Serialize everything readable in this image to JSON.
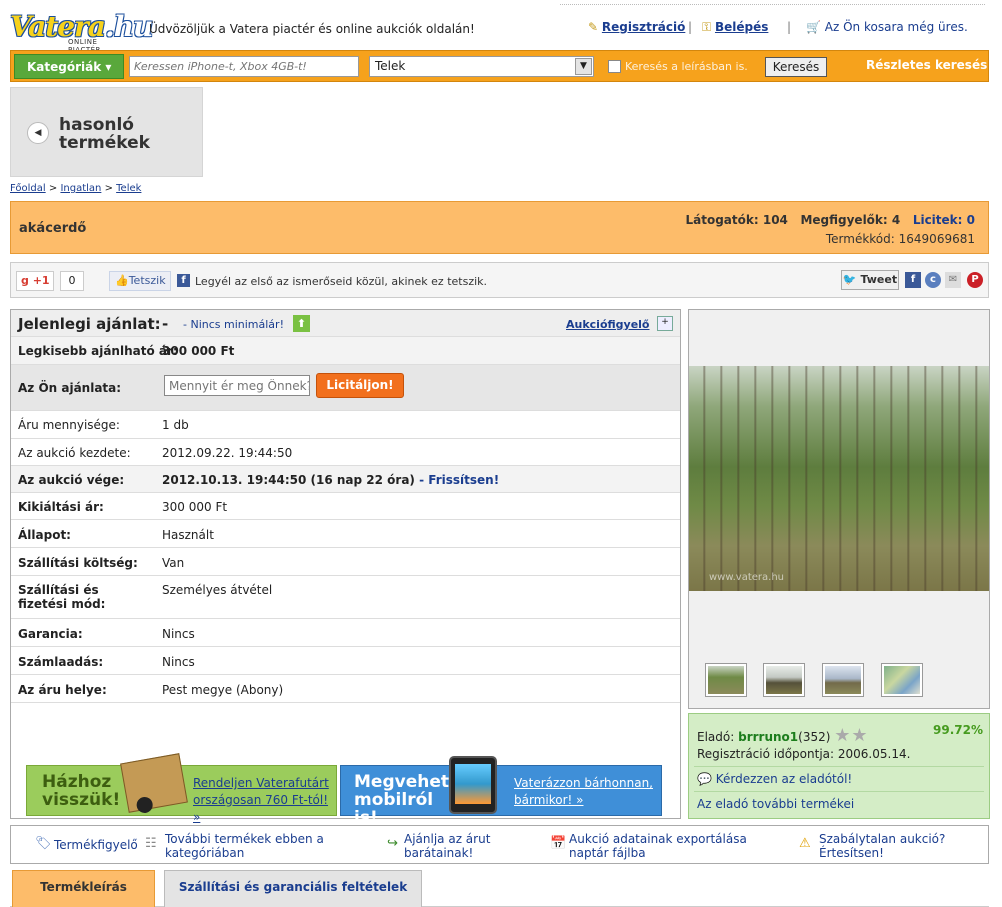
{
  "header": {
    "logo_text": "Vatera",
    "logo_domain": ".hu",
    "logo_sub": "ONLINE PIACTÉR",
    "welcome": "Üdvözöljük a Vatera piactér és online aukciók oldalán!",
    "register": "Regisztráció",
    "login": "Belépés",
    "sep": "|",
    "cart": "Az Ön kosara még üres."
  },
  "search": {
    "categories_btn": "Kategóriák ▾",
    "placeholder": "Keressen iPhone-t, Xbox 4GB-t!",
    "selected_category": "Telek",
    "in_description": "Keresés a leírásban is.",
    "search_btn": "Keresés",
    "advanced": "Részletes keresés"
  },
  "similar": {
    "label": "hasonló termékek"
  },
  "breadcrumb": [
    "Főoldal",
    "Ingatlan",
    "Telek"
  ],
  "breadcrumb_sep": ">",
  "title": {
    "name": "akácerdő",
    "visitors_label": "Látogatók:",
    "visitors": "104",
    "watchers_label": "Megfigyelők:",
    "watchers": "4",
    "bids_label": "Licitek:",
    "bids": "0",
    "code_label": "Termékkód:",
    "code": "1649069681"
  },
  "social": {
    "gplus": "+1",
    "gplus_count": "0",
    "like": "Tetszik",
    "fb_text": "Legyél az első az ismerőseid közül, akinek ez tetszik.",
    "tweet": "Tweet"
  },
  "offer": {
    "current_label": "Jelenlegi ajánlat:",
    "current_value": "-",
    "no_minimum": "- Nincs minimálár!",
    "watch": "Aukciófigyelő",
    "min_bid_label": "Legkisebb ajánlható ár:",
    "min_bid": "300 000 Ft",
    "your_bid_label": "Az Ön ajánlata:",
    "bid_placeholder": "Mennyit ér meg Önnek?",
    "bid_btn": "Licitáljon!",
    "rows": [
      {
        "k": "Áru mennyisége:",
        "v": "1 db"
      },
      {
        "k": "Az aukció kezdete:",
        "v": "2012.09.22. 19:44:50"
      },
      {
        "k": "Az aukció vége:",
        "v": "2012.10.13. 19:44:50 (16 nap 22 óra)",
        "link": "- Frissítsen!"
      },
      {
        "k": "Kikiáltási ár:",
        "v": "300 000 Ft"
      },
      {
        "k": "Állapot:",
        "v": "Használt"
      },
      {
        "k": "Szállítási költség:",
        "v": "Van"
      },
      {
        "k": "Szállítási és fizetési mód:",
        "v": "Személyes átvétel"
      },
      {
        "k": "Garancia:",
        "v": "Nincs"
      },
      {
        "k": "Számlaadás:",
        "v": "Nincs"
      },
      {
        "k": "Az áru helye:",
        "v": "Pest megye (Abony)"
      }
    ]
  },
  "banners": {
    "b1_title": "Házhoz visszük!",
    "b1_link": "Rendeljen Vaterafutárt országosan 760 Ft-tól! »",
    "b2_title": "Megveheti mobilról is!",
    "b2_link": "Vaterázzon bárhonnan, bármikor! »"
  },
  "image": {
    "watermark": "www.vatera.hu"
  },
  "seller": {
    "label": "Eladó:",
    "name": "brrruno1",
    "rating": "(352)",
    "percent": "99.72%",
    "reg_label": "Regisztráció időpontja:",
    "reg_date": "2006.05.14.",
    "ask": "Kérdezzen az eladótól!",
    "more": "Az eladó további termékei"
  },
  "actions": {
    "watcher": "Termékfigyelő",
    "more_in_cat": "További termékek ebben a kategóriában",
    "recommend": "Ajánlja az árut barátainak!",
    "export": "Aukció adatainak exportálása naptár fájlba",
    "report": "Szabálytalan aukció? Értesítsen!"
  },
  "tabs": {
    "description": "Termékleírás",
    "shipping": "Szállítási és garanciális feltételek"
  },
  "colors": {
    "orange": "#f6a21c",
    "green": "#59a83b",
    "title_bg": "#fdbc6a",
    "link": "#1a3d8f",
    "seller_bg": "#d4edc6"
  }
}
